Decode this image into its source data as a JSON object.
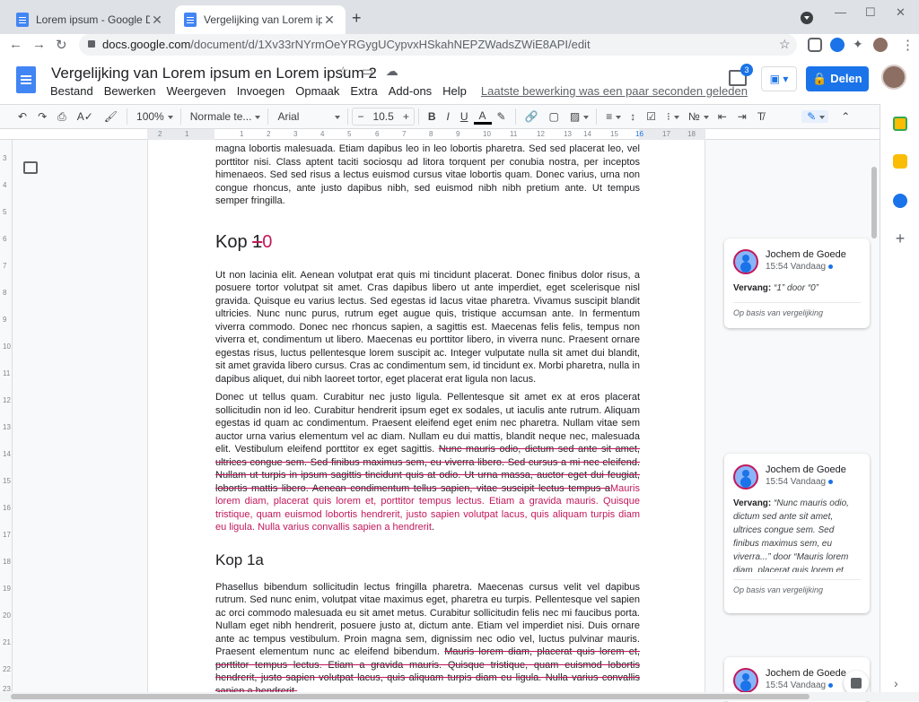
{
  "browser": {
    "tabs": [
      {
        "title": "Lorem ipsum - Google Documen",
        "active": false
      },
      {
        "title": "Vergelijking van Lorem ipsum en",
        "active": true
      }
    ],
    "url_host": "docs.google.com",
    "url_path": "/document/d/1Xv33rNYrmOeYRGygUCypvxHSkahNEPZWadsZWiE8API/edit",
    "new_tab": "+",
    "minimize": "—",
    "maximize": "☐",
    "close": "✕"
  },
  "docs": {
    "title": "Vergelijking van Lorem ipsum en Lorem ipsum 2",
    "menu": [
      "Bestand",
      "Bewerken",
      "Weergeven",
      "Invoegen",
      "Opmaak",
      "Extra",
      "Add-ons",
      "Help"
    ],
    "last_edit": "Laatste bewerking was een paar seconden geleden",
    "share_label": "Delen",
    "comments_count": "3"
  },
  "toolbar": {
    "zoom": "100%",
    "style": "Normale te...",
    "font": "Arial",
    "font_size": "10.5"
  },
  "ruler": {
    "h_labels": [
      "2",
      "1",
      "1",
      "2",
      "3",
      "4",
      "5",
      "6",
      "7",
      "8",
      "9",
      "10",
      "11",
      "12",
      "13",
      "14",
      "15",
      "16",
      "17",
      "18"
    ],
    "v_labels": [
      "3",
      "4",
      "5",
      "6",
      "7",
      "8",
      "9",
      "10",
      "11",
      "12",
      "13",
      "14",
      "15",
      "16",
      "17",
      "18",
      "19",
      "20",
      "21",
      "22",
      "23"
    ]
  },
  "document": {
    "p0": "magna lobortis malesuada. Etiam dapibus leo in leo lobortis pharetra. Sed sed placerat leo, vel porttitor nisi. Class aptent taciti sociosqu ad litora torquent per conubia nostra, per inceptos himenaeos. Sed sed risus a lectus euismod cursus vitae lobortis quam. Donec varius, urna non congue rhoncus, ante justo dapibus nibh, sed euismod nibh nibh pretium ante. Ut tempus semper fringilla.",
    "h1_prefix": "Kop ",
    "h1_deleted": "1",
    "h1_inserted": "0",
    "p1": "Ut non lacinia elit. Aenean volutpat erat quis mi tincidunt placerat. Donec finibus dolor risus, a posuere tortor volutpat sit amet. Cras dapibus libero ut ante imperdiet, eget scelerisque nisl gravida. Quisque eu varius lectus. Sed egestas id lacus vitae pharetra. Vivamus suscipit blandit ultricies. Nunc nunc purus, rutrum eget augue quis, tristique accumsan ante. In fermentum viverra commodo. Donec nec rhoncus sapien, a sagittis est. Maecenas felis felis, tempus non viverra et, condimentum ut libero. Maecenas eu porttitor libero, in viverra nunc. Praesent ornare egestas risus, luctus pellentesque lorem suscipit ac. Integer vulputate nulla sit amet dui blandit, sit amet gravida libero cursus. Cras ac condimentum sem, id tincidunt ex. Morbi pharetra, nulla in dapibus aliquet, dui nibh laoreet tortor, eget placerat erat ligula non lacus.",
    "p2_plain": "Donec ut tellus quam. Curabitur nec justo ligula. Pellentesque sit amet ex at eros placerat sollicitudin non id leo. Curabitur hendrerit ipsum eget ex sodales, ut iaculis ante rutrum. Aliquam egestas id quam ac condimentum. Praesent eleifend eget enim nec pharetra. Nullam vitae sem auctor urna varius elementum vel ac diam. Nullam eu dui mattis, blandit neque nec, malesuada elit. Vestibulum eleifend porttitor ex eget sagittis. ",
    "p2_deleted": "Nunc mauris odio, dictum sed ante sit amet, ultrices congue sem. Sed finibus maximus sem, eu viverra libero. Sed cursus a mi nec eleifend. Nullam ut turpis in ipsum sagittis tincidunt quis at odio. Ut urna massa, auctor eget dui feugiat, lobortis mattis libero. Aenean condimentum tellus sapien, vitae suscipit lectus tempus a",
    "p2_inserted": "Mauris lorem diam, placerat quis lorem et, porttitor tempus lectus. Etiam a gravida mauris. Quisque tristique, quam euismod lobortis hendrerit, justo sapien volutpat lacus, quis aliquam turpis diam eu ligula. Nulla varius convallis sapien a hendrerit",
    "p2_end": ".",
    "h2": "Kop 1a",
    "p3_plain": "Phasellus bibendum sollicitudin lectus fringilla pharetra. Maecenas cursus velit vel dapibus rutrum. Sed nunc enim, volutpat vitae maximus eget, pharetra eu turpis. Pellentesque vel sapien ac orci commodo malesuada eu sit amet metus. Curabitur sollicitudin felis nec mi faucibus porta. Nullam eget nibh hendrerit, posuere justo at, dictum ante. Etiam vel imperdiet nisi. Duis ornare ante ac tempus vestibulum. Proin magna sem, dignissim nec odio vel, luctus pulvinar mauris. Praesent elementum nunc ac eleifend bibendum. ",
    "p3_deleted": "Mauris lorem diam, placerat quis lorem et, porttitor tempus lectus. Etiam a gravida mauris. Quisque tristique, quam euismod lobortis hendrerit, justo sapien volutpat lacus, quis aliquam turpis diam eu ligula. Nulla varius convallis sapien a hendrerit."
  },
  "comments": [
    {
      "author": "Jochem de Goede",
      "time": "15:54 Vandaag",
      "action": "Vervang:",
      "detail": "“1” door “0”",
      "footer": "Op basis van vergelijking"
    },
    {
      "author": "Jochem de Goede",
      "time": "15:54 Vandaag",
      "action": "Vervang:",
      "detail": "“Nunc mauris odio, dictum sed ante sit amet, ultrices congue sem. Sed finibus maximus sem, eu viverra...” door “Mauris lorem diam, placerat quis lorem et, porttitor tempus lectus. Etiam a gravida mauris. Quisque ...”",
      "footer": "Op basis van vergelijking"
    },
    {
      "author": "Jochem de Goede",
      "time": "15:54 Vandaag"
    }
  ],
  "colors": {
    "accent": "#1a73e8",
    "suggestion": "#c2185b"
  }
}
